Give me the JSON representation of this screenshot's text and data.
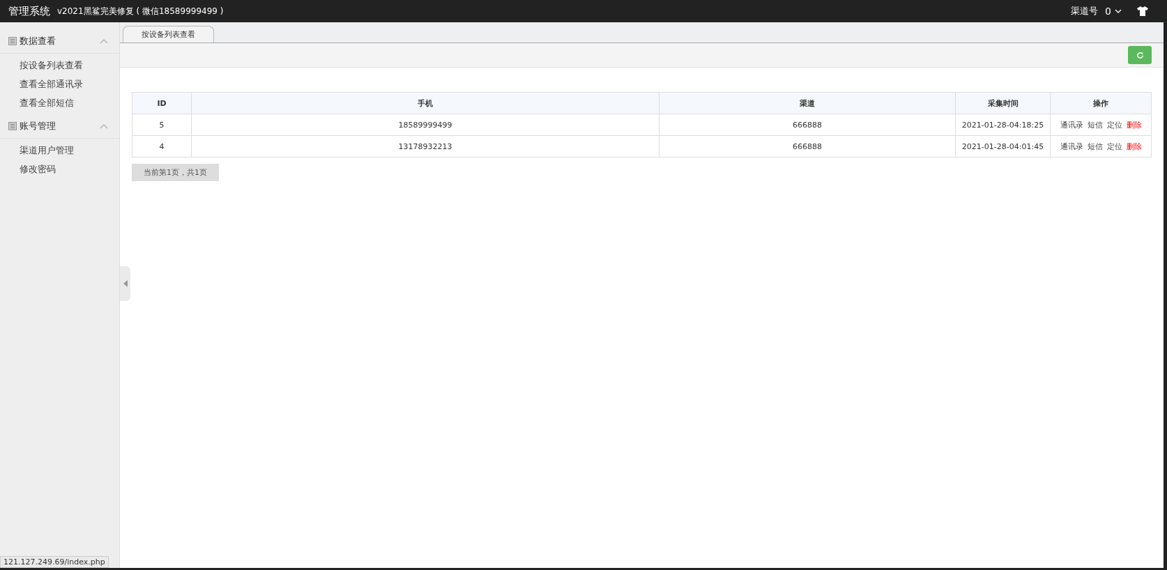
{
  "header": {
    "title": "管理系统",
    "subtitle": "v2021黑鲨完美修复 ( 微信18589999499 )",
    "channel_label": "渠道号",
    "channel_value": "0"
  },
  "sidebar": {
    "groups": [
      {
        "label": "数据查看",
        "expanded": true,
        "items": [
          {
            "label": "按设备列表查看",
            "selected": false
          },
          {
            "label": "查看全部通讯录",
            "selected": false
          },
          {
            "label": "查看全部短信",
            "selected": false
          }
        ]
      },
      {
        "label": "账号管理",
        "expanded": true,
        "items": [
          {
            "label": "渠道用户管理",
            "selected": false
          },
          {
            "label": "修改密码",
            "selected": false
          }
        ]
      }
    ]
  },
  "tabs": [
    {
      "label": "按设备列表查看",
      "selected": true
    }
  ],
  "table": {
    "columns": [
      "ID",
      "手机",
      "渠道",
      "采集时间",
      "操作"
    ],
    "rows": [
      {
        "cells": [
          "5",
          "18589999499",
          "666888",
          "2021-01-28-04:18:25"
        ],
        "actions": [
          {
            "label": "通讯录",
            "kind": "link"
          },
          {
            "label": "短信",
            "kind": "link"
          },
          {
            "label": "定位",
            "kind": "link"
          },
          {
            "label": "删除",
            "kind": "delete"
          }
        ]
      },
      {
        "cells": [
          "4",
          "13178932213",
          "666888",
          "2021-01-28-04:01:45"
        ],
        "actions": [
          {
            "label": "通讯录",
            "kind": "link"
          },
          {
            "label": "短信",
            "kind": "link"
          },
          {
            "label": "定位",
            "kind": "link"
          },
          {
            "label": "删除",
            "kind": "delete"
          }
        ]
      }
    ]
  },
  "pagination": "当前第1页，共1页",
  "status_bar": "121.127.249.69/index.php"
}
